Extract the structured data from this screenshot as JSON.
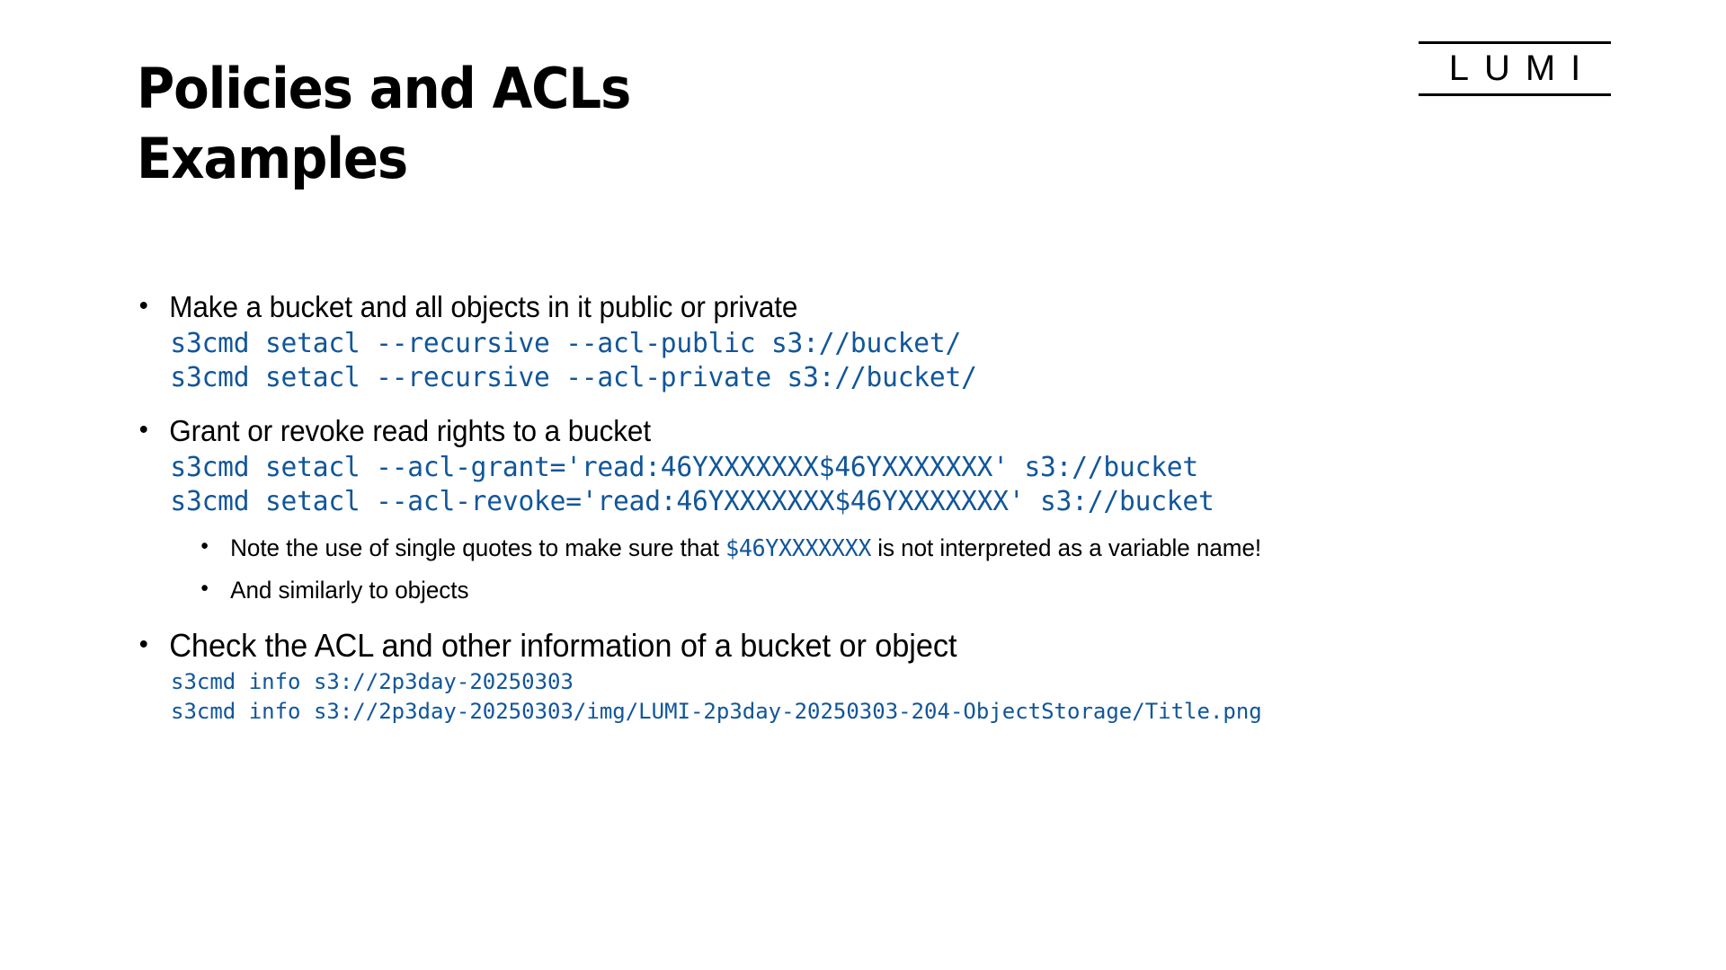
{
  "slide": {
    "title_line_1": "Policies and ACLs",
    "title_line_2": "Examples",
    "background_color": "#ffffff",
    "code_color": "#115699",
    "text_color": "#000000"
  },
  "logo": {
    "word": "LUMI"
  },
  "content": {
    "bullet_1": {
      "text": "Make a bucket and all objects in it public or private",
      "code_lines": [
        "s3cmd setacl --recursive --acl-public s3://bucket/",
        "s3cmd setacl --recursive --acl-private s3://bucket/"
      ]
    },
    "bullet_2": {
      "text": "Grant or revoke read rights to a bucket",
      "code_lines": [
        "s3cmd setacl --acl-grant='read:46YXXXXXXX$46YXXXXXXX' s3://bucket",
        "s3cmd setacl --acl-revoke='read:46YXXXXXXX$46YXXXXXXX' s3://bucket"
      ],
      "sub_bullets": [
        {
          "prefix": "Note the use of single quotes to make sure that ",
          "code": "$46YXXXXXXX",
          "suffix": " is not interpreted as a variable name!"
        },
        {
          "prefix": "And similarly to objects",
          "code": "",
          "suffix": ""
        }
      ]
    },
    "bullet_3": {
      "text": "Check the ACL and other information of a bucket or object",
      "code_lines": [
        "s3cmd info s3://2p3day-20250303",
        "s3cmd info s3://2p3day-20250303/img/LUMI-2p3day-20250303-204-ObjectStorage/Title.png"
      ]
    }
  }
}
